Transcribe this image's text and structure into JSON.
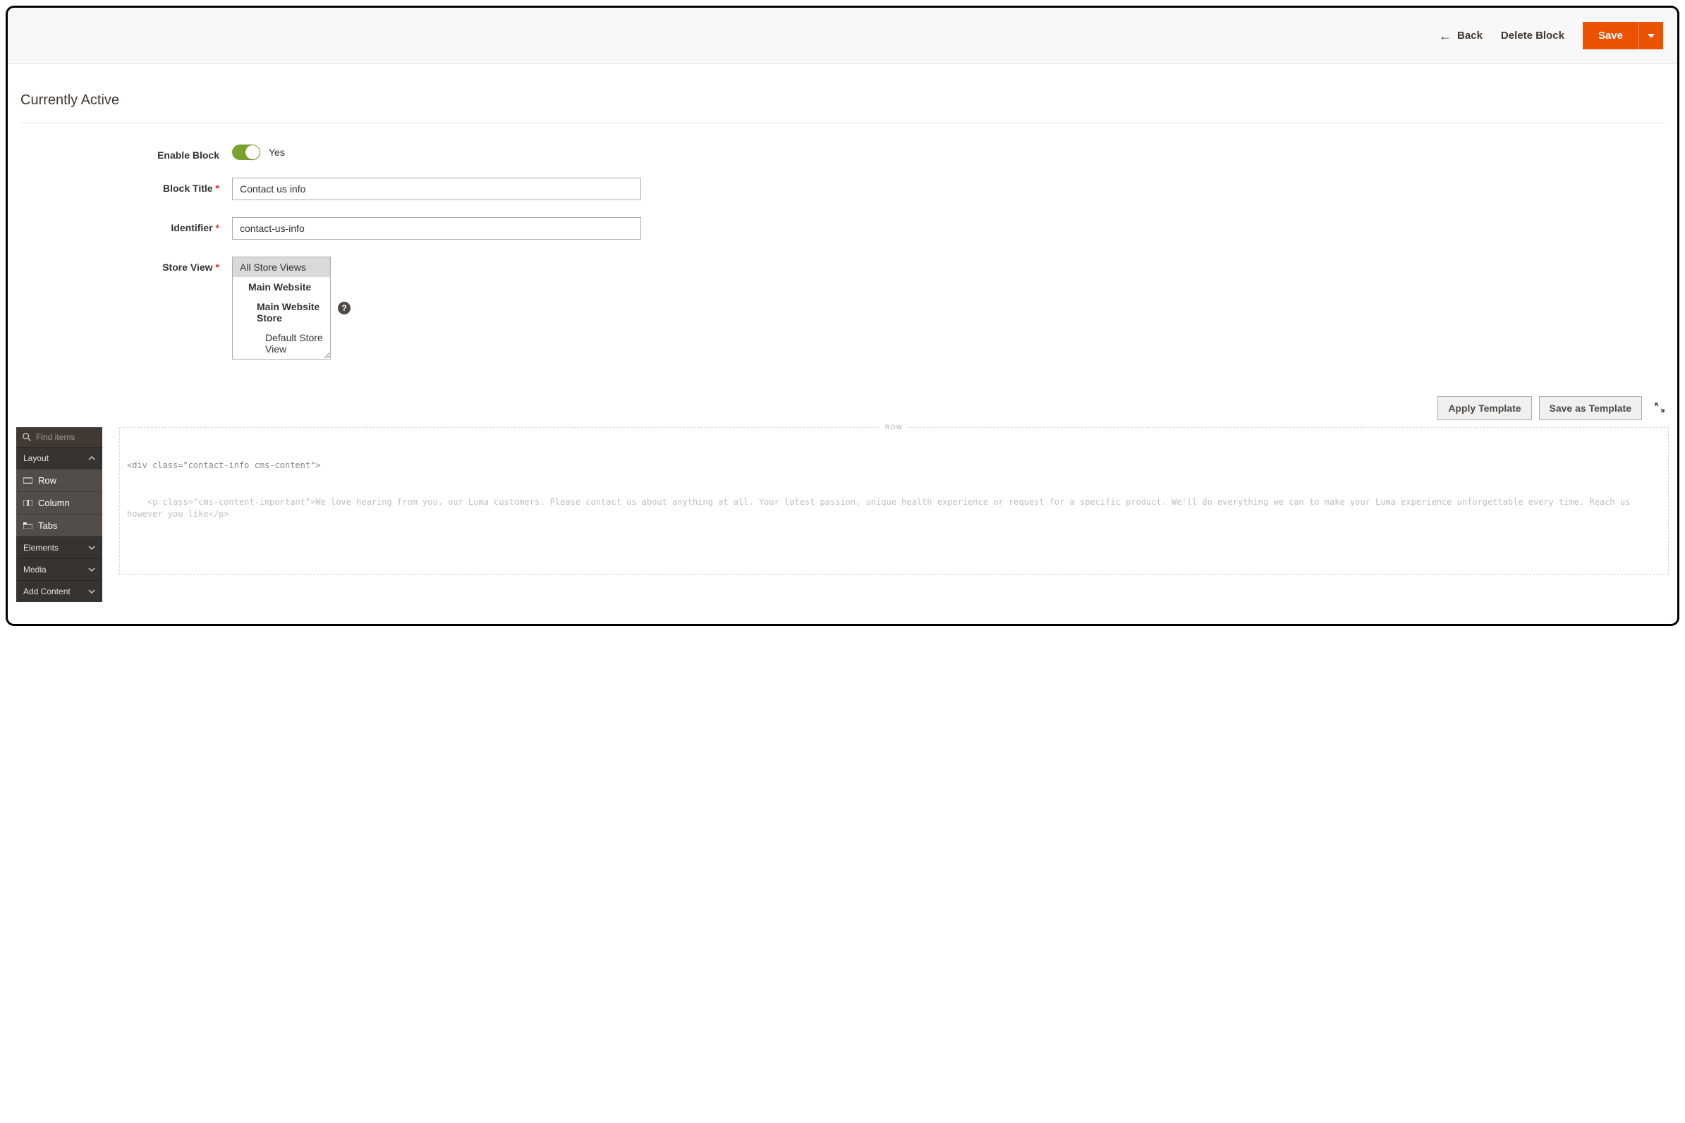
{
  "toolbar": {
    "back_label": "Back",
    "delete_label": "Delete Block",
    "save_label": "Save"
  },
  "page": {
    "title": "Currently Active"
  },
  "form": {
    "enable_block_label": "Enable Block",
    "enable_block_value": "Yes",
    "block_title_label": "Block Title",
    "block_title_value": "Contact us info",
    "identifier_label": "Identifier",
    "identifier_value": "contact-us-info",
    "store_view_label": "Store View",
    "store_view_options": {
      "all": "All Store Views",
      "website": "Main Website",
      "store": "Main Website Store",
      "view": "Default Store View"
    }
  },
  "templates": {
    "apply": "Apply Template",
    "saveas": "Save as Template"
  },
  "panel": {
    "search_placeholder": "Find items",
    "groups": {
      "layout": "Layout",
      "elements": "Elements",
      "media": "Media",
      "add_content": "Add Content"
    },
    "layout_items": {
      "row": "Row",
      "column": "Column",
      "tabs": "Tabs"
    }
  },
  "stage": {
    "row_label": "ROW",
    "code_line1": "<div class=\"contact-info cms-content\">",
    "code_line2": "    <p class=\"cms-content-important\">We love hearing from you, our Luma customers. Please contact us about anything at all. Your latest passion, unique health experience or request for a specific product. We'll do everything we can to make your Luma experience unforgettable every time. Reach us however you like</p>"
  }
}
